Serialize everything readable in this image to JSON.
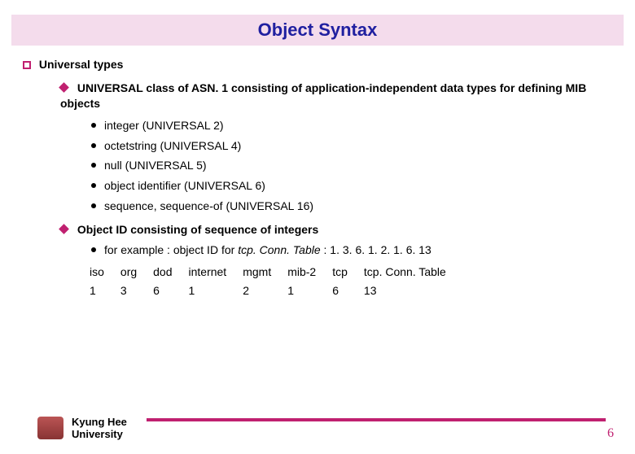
{
  "slide": {
    "title": "Object Syntax",
    "section": "Universal types",
    "bullets": [
      {
        "lead": "UNIVERSAL",
        "text": " class  of ASN. 1 consisting of application-independent data types for defining MIB objects",
        "items": [
          "integer (UNIVERSAL 2)",
          "octetstring (UNIVERSAL 4)",
          "null (UNIVERSAL 5)",
          "object identifier (UNIVERSAL 6)",
          "sequence, sequence-of (UNIVERSAL 16)"
        ]
      },
      {
        "lead": "Object ID",
        "text": " consisting of sequence of integers",
        "example_prefix": "for example : object ID for ",
        "example_italic": "tcp. Conn. Table",
        "example_suffix": " : 1. 3. 6. 1. 2. 1. 6. 13",
        "oid_labels": [
          "iso",
          "org",
          "dod",
          "internet",
          "mgmt",
          "mib-2",
          "tcp",
          "tcp. Conn. Table"
        ],
        "oid_values": [
          "1",
          "3",
          "6",
          "1",
          "2",
          "1",
          "6",
          "13"
        ]
      }
    ]
  },
  "footer": {
    "university_line1": "Kyung Hee",
    "university_line2": "University",
    "page_number": "6"
  },
  "colors": {
    "accent": "#c02070",
    "title_text": "#2020a0",
    "title_bg": "#f4dcec"
  }
}
